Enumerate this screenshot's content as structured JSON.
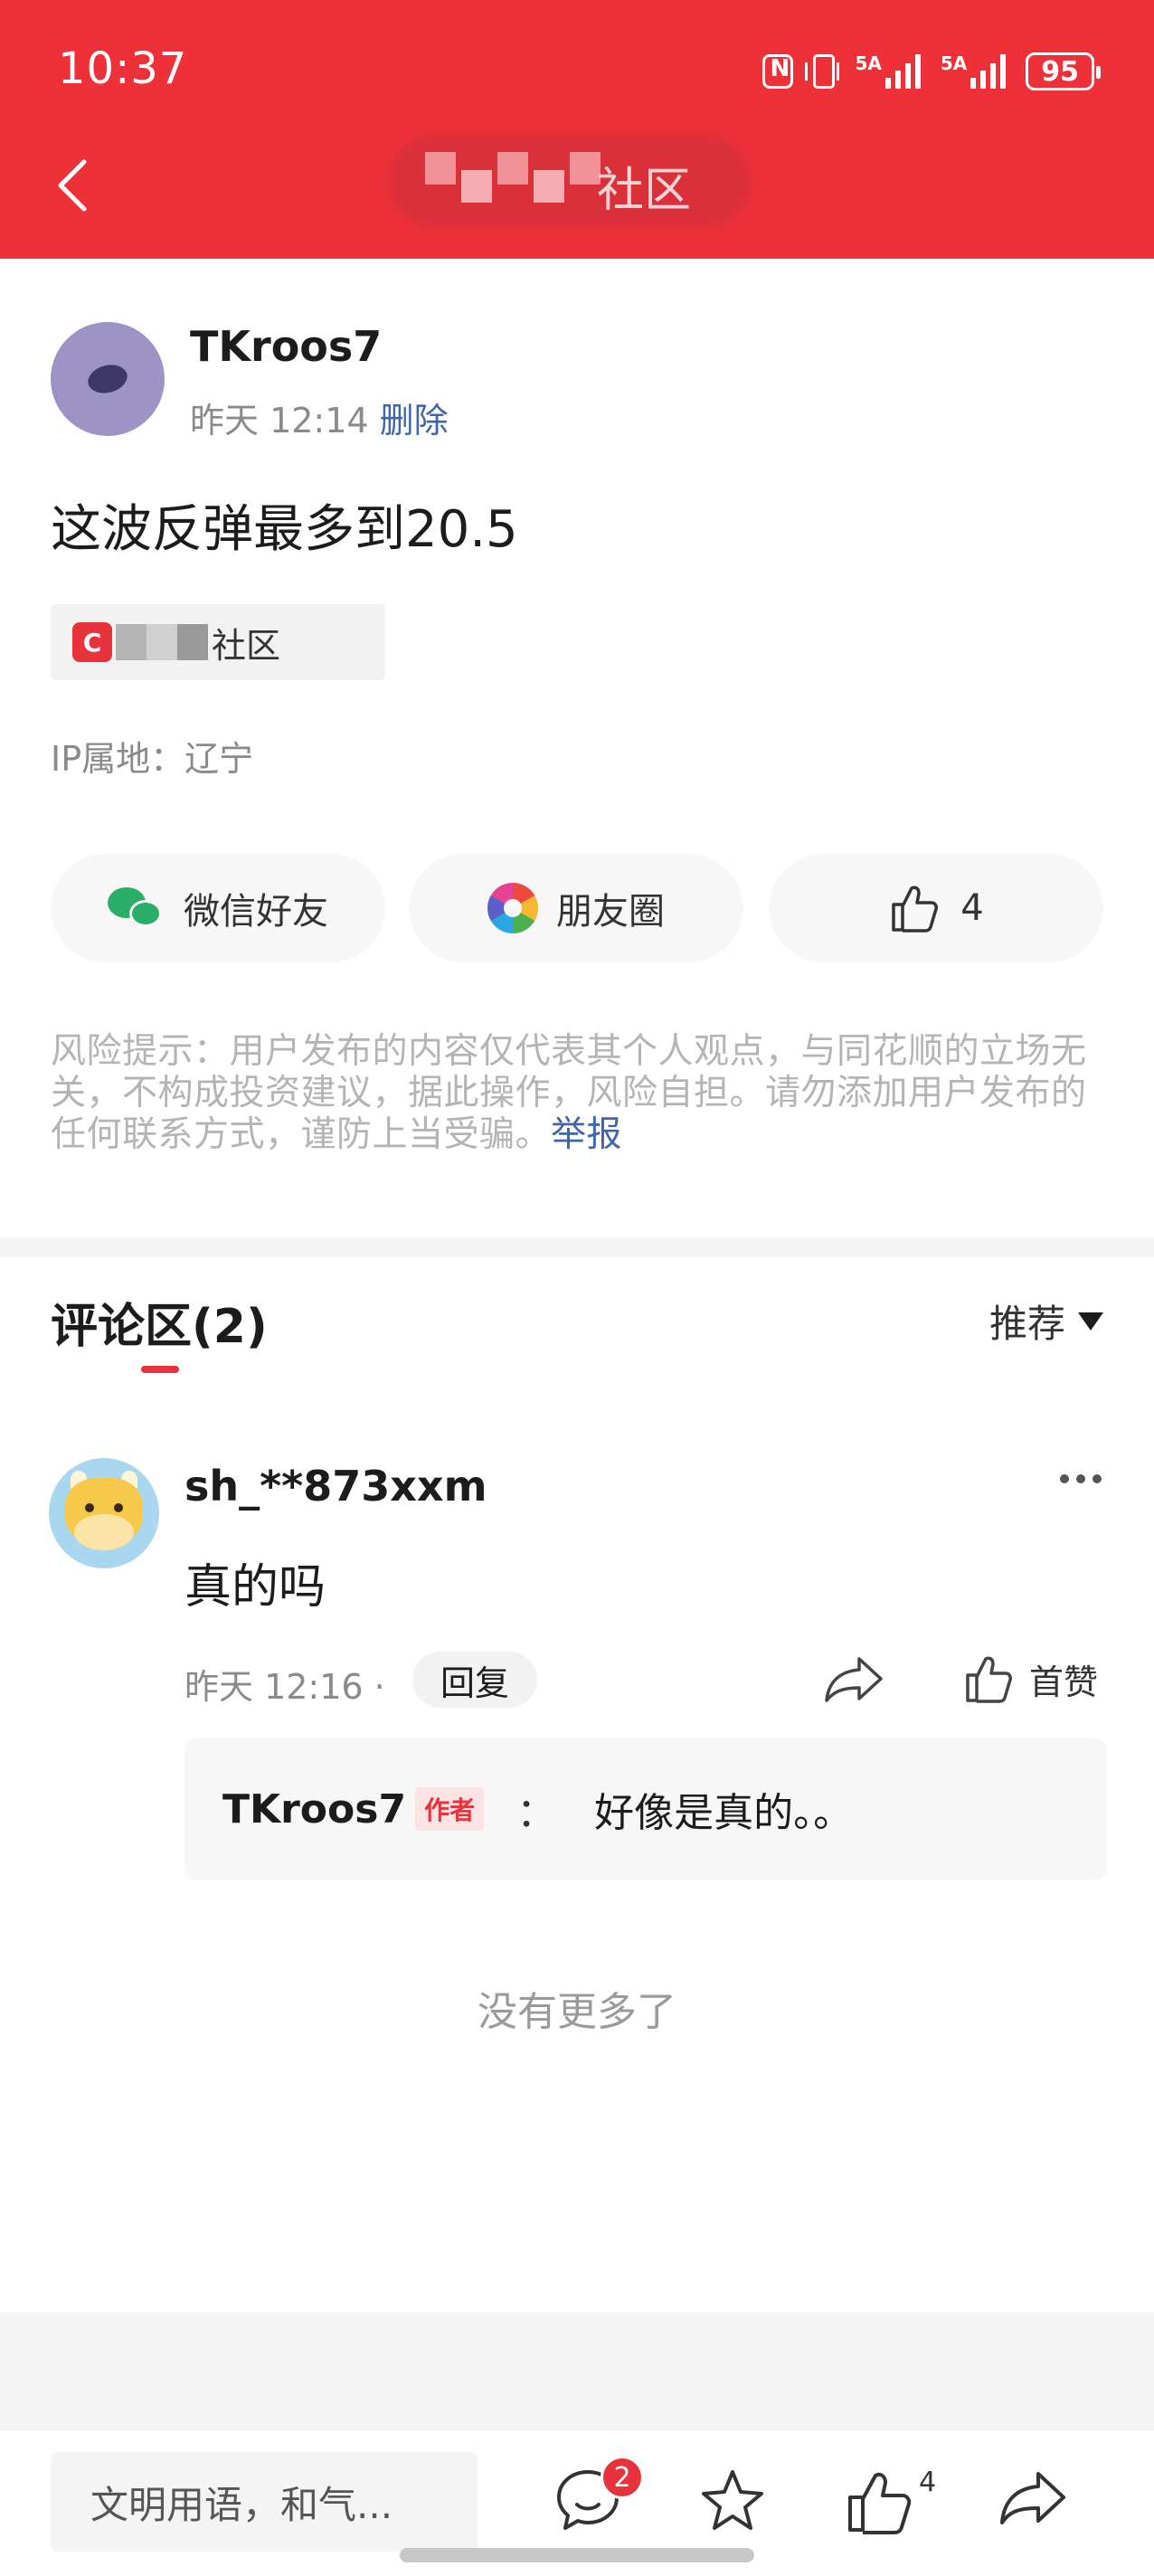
{
  "status_bar": {
    "time": "10:37",
    "network_1": "5A",
    "network_2": "5A",
    "battery": "95"
  },
  "header": {
    "title": "社区"
  },
  "post": {
    "author": "TKroos7",
    "time": "昨天 12:14",
    "delete_label": "删除",
    "text": "这波反弹最多到20.5",
    "community_name": "社区",
    "ip_location": "IP属地：辽宁",
    "share_wechat": "微信好友",
    "share_moments": "朋友圈",
    "like_count": "4",
    "risk_notice": "风险提示：用户发布的内容仅代表其个人观点，与同花顺的立场无关，不构成投资建议，据此操作，风险自担。请勿添加用户发布的任何联系方式，谨防上当受骗。",
    "report_label": "举报"
  },
  "comments": {
    "title": "评论区(2)",
    "sort_label": "推荐",
    "items": [
      {
        "user": "sh_**873xxm",
        "text": "真的吗",
        "time": "昨天 12:16 ·",
        "reply_label": "回复",
        "like_label": "首赞",
        "reply": {
          "author": "TKroos7",
          "badge": "作者",
          "colon": "：",
          "text": "好像是真的。。"
        }
      }
    ],
    "no_more": "没有更多了"
  },
  "bottom_bar": {
    "input_placeholder": "文明用语，和气...",
    "message_badge": "2",
    "like_count": "4"
  },
  "colors": {
    "brand_red": "#ee3039",
    "link_blue": "#3f67a8",
    "wechat_green": "#2aae67"
  }
}
